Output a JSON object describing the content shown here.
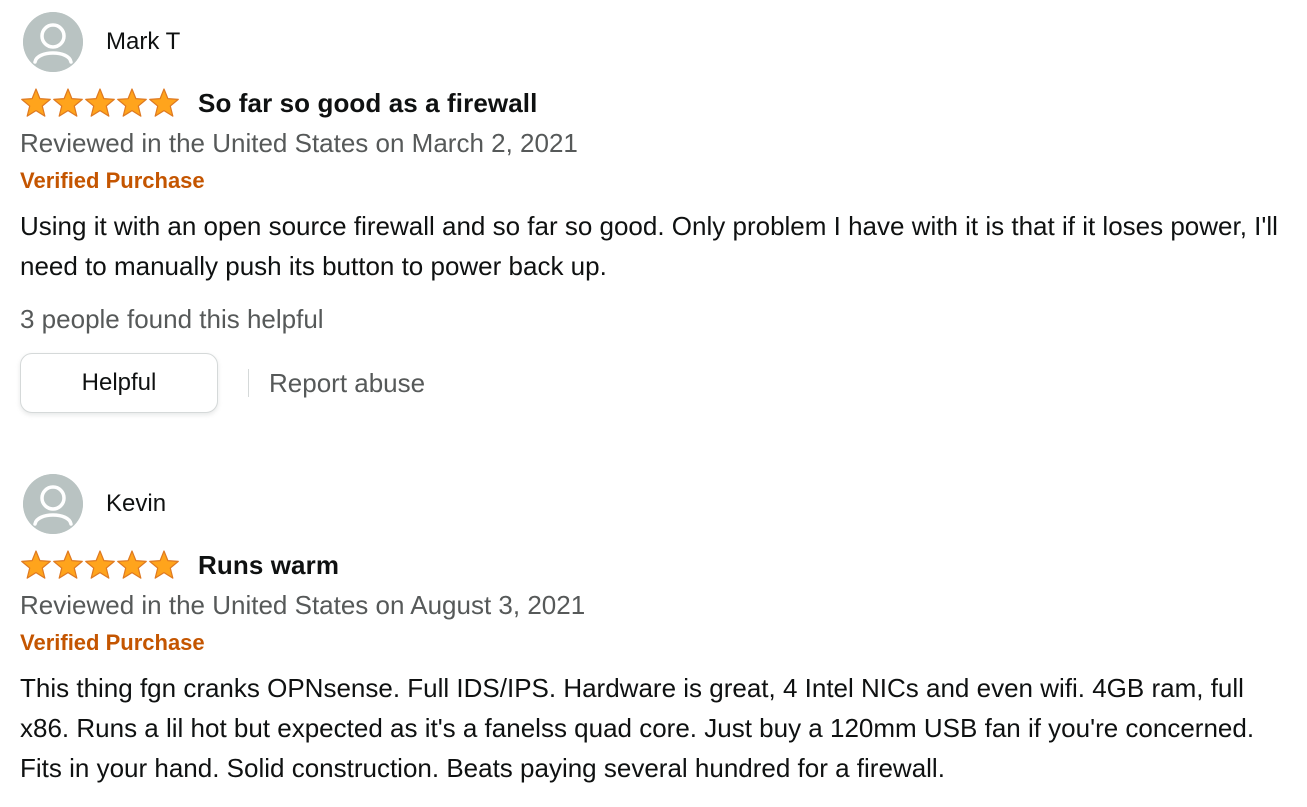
{
  "reviews": [
    {
      "reviewer": "Mark T",
      "rating": 5,
      "title": "So far so good as a firewall",
      "date": "Reviewed in the United States on March 2, 2021",
      "badge": "Verified Purchase",
      "body": "Using it with an open source firewall and so far so good. Only problem I have with it is that if it loses power, I'll need to manually push its button to power back up.",
      "helpful_count": "3 people found this helpful",
      "helpful_label": "Helpful",
      "report_label": "Report abuse"
    },
    {
      "reviewer": "Kevin",
      "rating": 5,
      "title": "Runs warm",
      "date": "Reviewed in the United States on August 3, 2021",
      "badge": "Verified Purchase",
      "body": "This thing fgn cranks OPNsense. Full IDS/IPS. Hardware is great, 4 Intel NICs and even wifi. 4GB ram, full x86. Runs a lil hot but expected as it's a fanelss quad core. Just buy a 120mm USB fan if you're concerned. Fits in your hand. Solid construction. Beats paying several hundred for a firewall."
    }
  ],
  "colors": {
    "star": "#ffa41c",
    "star_stroke": "#de7921",
    "verified": "#c45500",
    "secondary_text": "#565959",
    "avatar_bg": "#b9c3c2"
  },
  "icons": {
    "avatar": "default-profile-avatar-icon",
    "star": "filled-star-icon"
  }
}
